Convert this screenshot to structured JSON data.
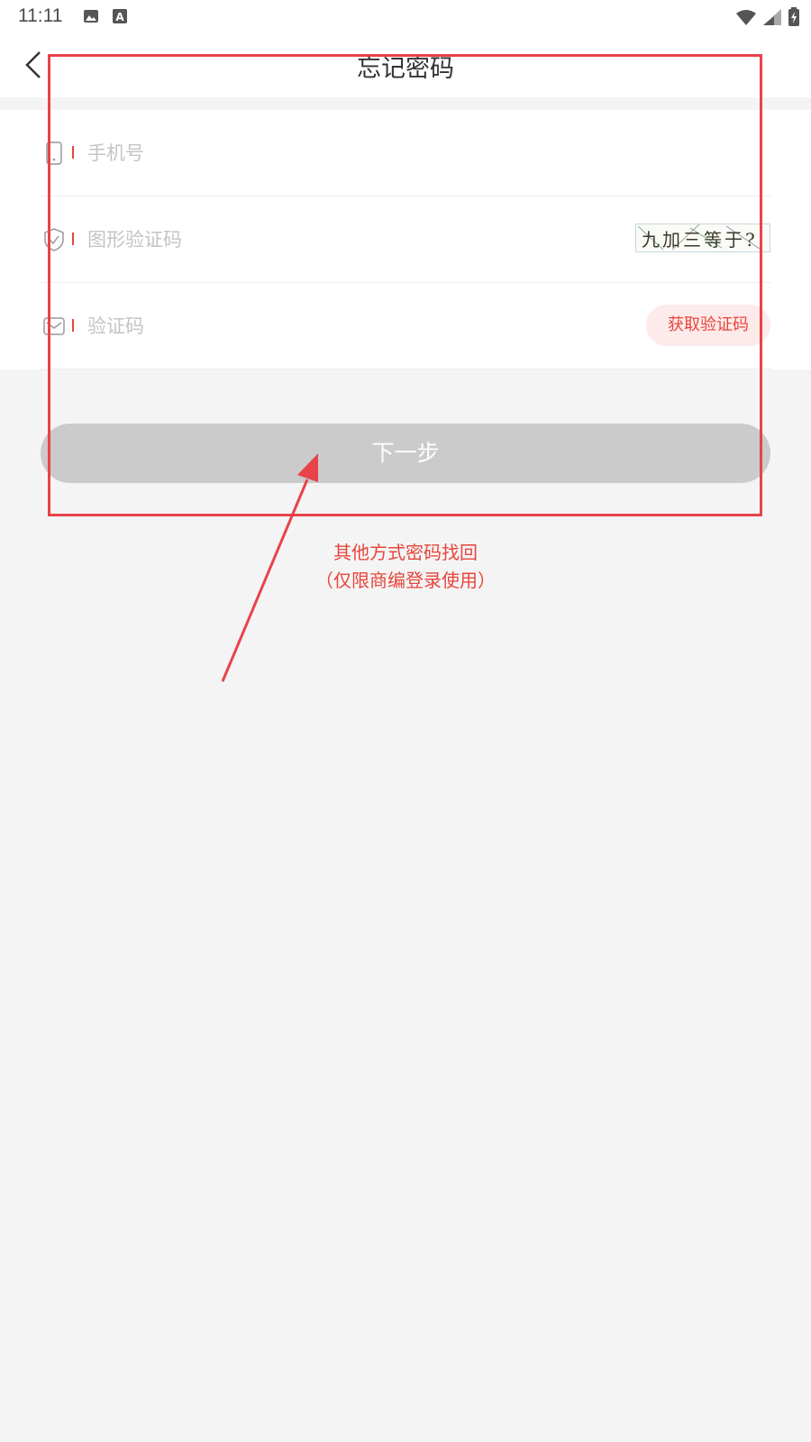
{
  "status_bar": {
    "time": "11:11",
    "icons": [
      "image-icon",
      "a-badge-icon",
      "wifi-icon",
      "signal-icon",
      "battery-icon"
    ]
  },
  "header": {
    "title": "忘记密码",
    "back_icon": "chevron-left-icon"
  },
  "form": {
    "phone": {
      "placeholder": "手机号",
      "icon": "phone-icon"
    },
    "captcha": {
      "placeholder": "图形验证码",
      "icon": "shield-icon",
      "image_text": "九加三等于?"
    },
    "code": {
      "placeholder": "验证码",
      "icon": "mail-icon",
      "button_label": "获取验证码"
    }
  },
  "next_button": {
    "label": "下一步"
  },
  "other_recovery": {
    "line1": "其他方式密码找回",
    "line2": "（仅限商编登录使用）"
  },
  "colors": {
    "accent": "#e8453c",
    "accent_light": "#fdeaea",
    "disabled_button": "#cbcbcb",
    "page_bg": "#f4f4f4",
    "annotation": "#e8434a"
  }
}
